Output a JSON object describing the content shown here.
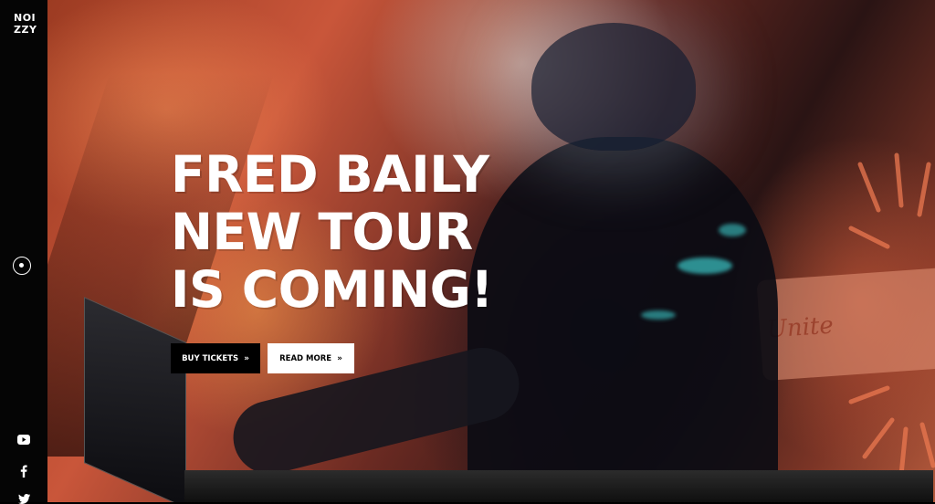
{
  "brand": {
    "line1": "NOI",
    "line2": "ZZY"
  },
  "menu": {
    "icon": "menu-circle-icon"
  },
  "social": [
    {
      "name": "youtube-icon"
    },
    {
      "name": "facebook-icon"
    },
    {
      "name": "twitter-icon"
    }
  ],
  "hero": {
    "headline": [
      "FRED BAILY",
      "NEW TOUR",
      "IS COMING!"
    ],
    "buttons": {
      "buy": {
        "label": "BUY TICKETS",
        "icon": "double-chevron-right-icon"
      },
      "more": {
        "label": "READ MORE",
        "icon": "double-chevron-right-icon"
      }
    },
    "mural_text": "Unite"
  },
  "colors": {
    "sidebar": "#050505",
    "button_dark": "#000000",
    "button_light": "#ffffff",
    "text": "#ffffff"
  }
}
